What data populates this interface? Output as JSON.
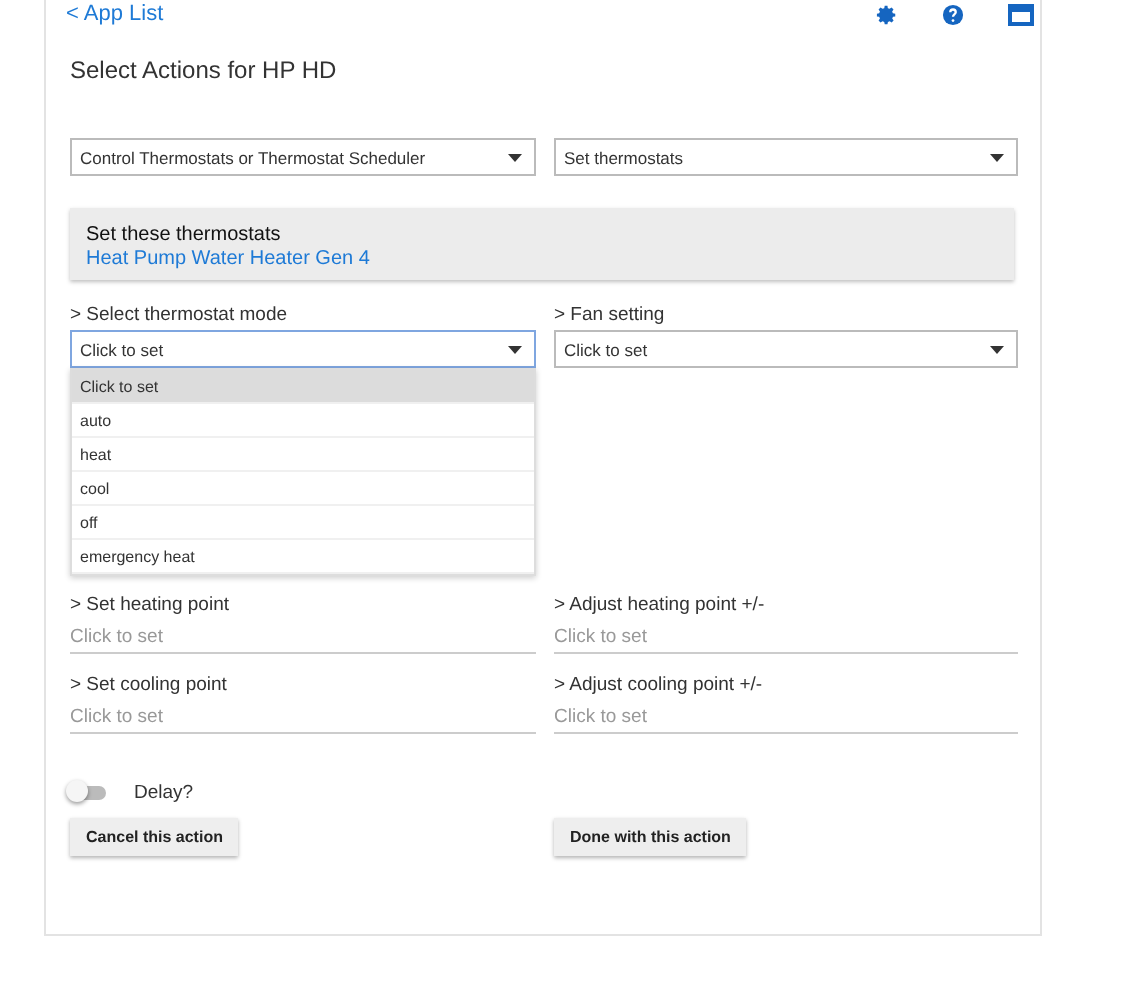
{
  "header": {
    "back_link": "< App List"
  },
  "title": "Select Actions for HP HD",
  "action_selects": [
    {
      "value": "Control Thermostats or Thermostat Scheduler"
    },
    {
      "value": "Set thermostats"
    }
  ],
  "device_panel": {
    "heading": "Set these thermostats",
    "device": "Heat Pump Water Heater Gen 4"
  },
  "mode_select": {
    "label": "> Select thermostat mode",
    "value": "Click to set",
    "expanded": true,
    "options": [
      {
        "label": "Click to set",
        "selected": true
      },
      {
        "label": "auto",
        "selected": false
      },
      {
        "label": "heat",
        "selected": false
      },
      {
        "label": "cool",
        "selected": false
      },
      {
        "label": "off",
        "selected": false
      },
      {
        "label": "emergency heat",
        "selected": false
      }
    ]
  },
  "fan_select": {
    "label": "> Fan setting",
    "value": "Click to set",
    "expanded": false
  },
  "setpoint_fields": [
    {
      "label": "> Set heating point",
      "placeholder": "Click to set"
    },
    {
      "label": "> Adjust heating point +/-",
      "placeholder": "Click to set"
    },
    {
      "label": "> Set cooling point",
      "placeholder": "Click to set"
    },
    {
      "label": "> Adjust cooling point +/-",
      "placeholder": "Click to set"
    }
  ],
  "delay_toggle": {
    "label": "Delay?",
    "on": false
  },
  "buttons": [
    "Cancel this action",
    "Done with this action"
  ]
}
